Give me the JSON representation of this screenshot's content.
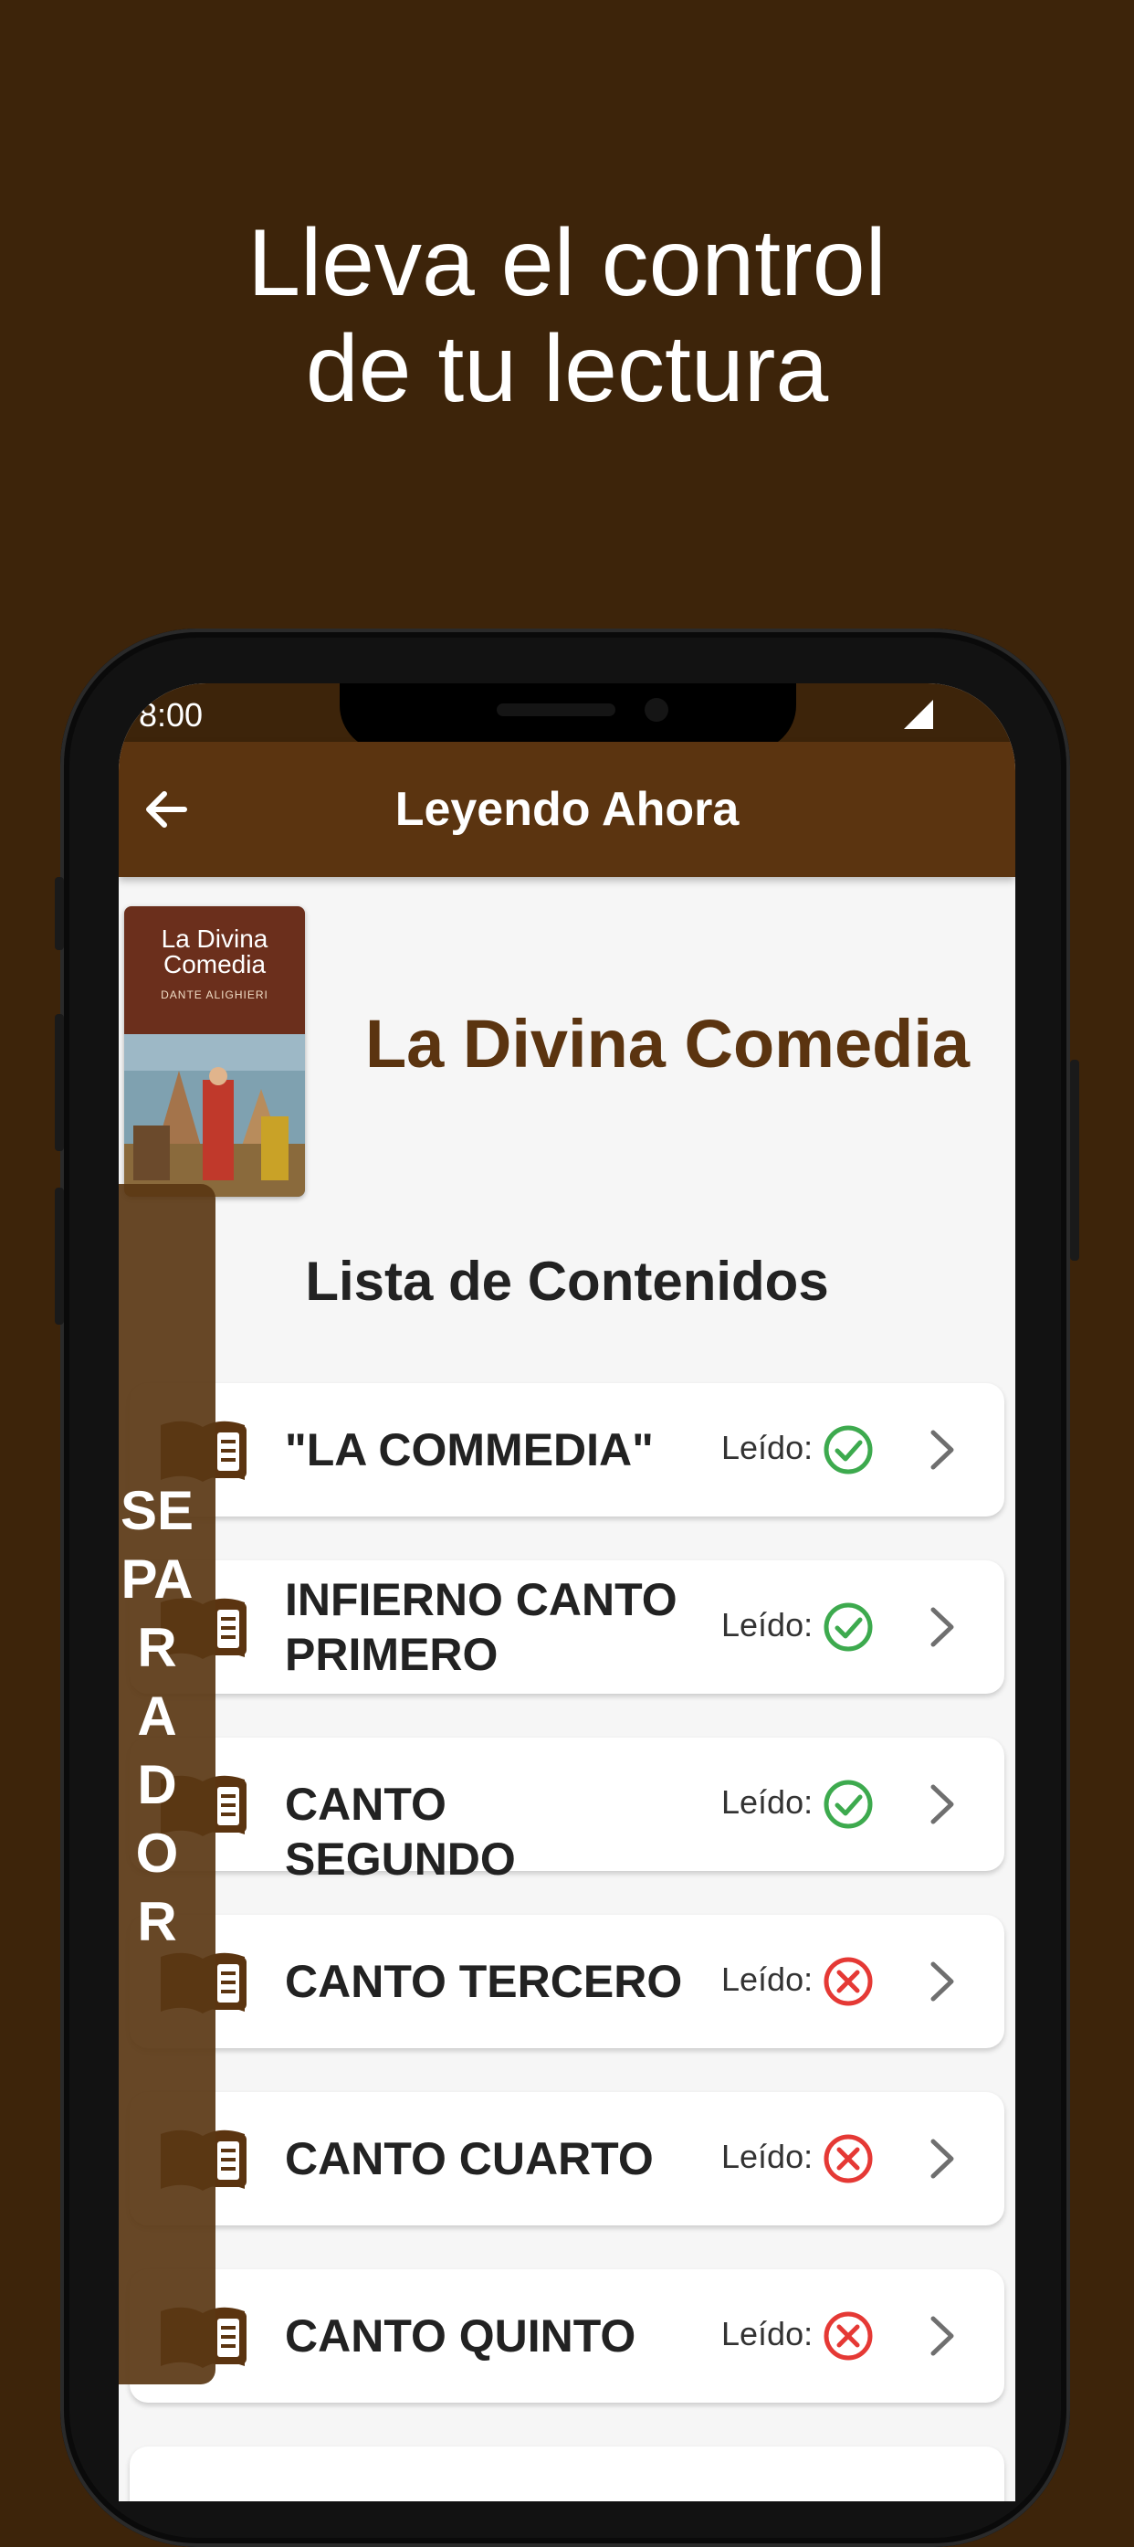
{
  "promo": {
    "line1": "Lleva el control",
    "line2": "de tu lectura"
  },
  "status_bar": {
    "time": "8:00"
  },
  "app_bar": {
    "title": "Leyendo Ahora"
  },
  "book": {
    "title": "La Divina Comedia",
    "cover": {
      "title_line1": "La Divina",
      "title_line2": "Comedia",
      "author": "DANTE ALIGHIERI"
    }
  },
  "contents": {
    "title": "Lista de Contenidos",
    "read_label": "Leído:",
    "items": [
      {
        "label": "\"LA COMMEDIA\"",
        "read": true
      },
      {
        "label": "INFIERNO CANTO PRIMERO",
        "read": true
      },
      {
        "label": "CANTO SEGUNDO",
        "read": true
      },
      {
        "label": "CANTO TERCERO",
        "read": false
      },
      {
        "label": "CANTO CUARTO",
        "read": false
      },
      {
        "label": "CANTO QUINTO",
        "read": false
      }
    ]
  },
  "bookmark": {
    "label": "SEPARADOR"
  },
  "colors": {
    "background": "#3d240a",
    "app_bar": "#5b3410",
    "title_brown": "#5b3410",
    "read_green": "#3daa4e",
    "unread_red": "#e53935"
  },
  "icons": {
    "back": "arrow-left-icon",
    "signal": "signal-icon",
    "item": "book-icon",
    "read": "check-circle-icon",
    "unread": "x-circle-icon",
    "chevron": "chevron-right-icon"
  }
}
